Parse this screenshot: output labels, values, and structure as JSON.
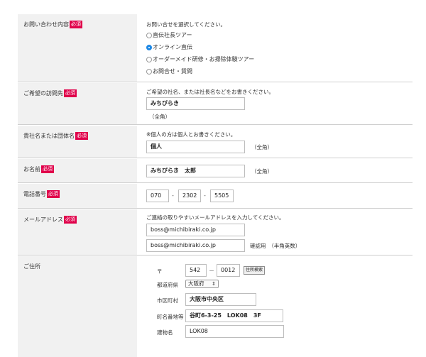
{
  "required_badge": "必須",
  "inquiry": {
    "label": "お問い合わせ内容",
    "instruction": "お問い合せを選択してください。",
    "options": [
      {
        "label": "直伝社長ツアー",
        "selected": false
      },
      {
        "label": "オンライン直伝",
        "selected": true
      },
      {
        "label": "オーダーメイド研修・お掃除体験ツアー",
        "selected": false
      },
      {
        "label": "お問合せ・質問",
        "selected": false
      }
    ]
  },
  "visit": {
    "label": "ご希望の訪問先",
    "instruction": "ご希望の社名、または社長名などをお書きください。",
    "value": "みちびらき",
    "hint": "（全角）"
  },
  "company": {
    "label": "貴社名または団体名",
    "instruction": "※個人の方は個人とお書きください。",
    "value": "個人",
    "hint": "（全角）"
  },
  "name": {
    "label": "お名前",
    "value": "みちびらき　太郎",
    "hint": "（全角）"
  },
  "phone": {
    "label": "電話番号",
    "part1": "070",
    "part2": "2302",
    "part3": "5505",
    "separator": "-"
  },
  "email": {
    "label": "メールアドレス",
    "instruction": "ご連絡の取りやすいメールアドレスを入力してください。",
    "value": "boss@michibiraki.co.jp",
    "confirm_value": "boss@michibiraki.co.jp",
    "confirm_hint": "確認用　（半角英数）"
  },
  "address": {
    "label": "ご住所",
    "zip_mark": "〒",
    "zip1": "542",
    "zip_separator": "－",
    "zip2": "0012",
    "zip_button": "住所検索",
    "prefecture_label": "都道府県",
    "prefecture_value": "大阪府",
    "prefecture_arrow": "⇕",
    "city_label": "市区町村",
    "city_value": "大阪市中央区",
    "street_label": "町名番地等",
    "street_value": "谷町6-3-25　LOK08　3F",
    "building_label": "建物名",
    "building_value": "LOK08"
  }
}
